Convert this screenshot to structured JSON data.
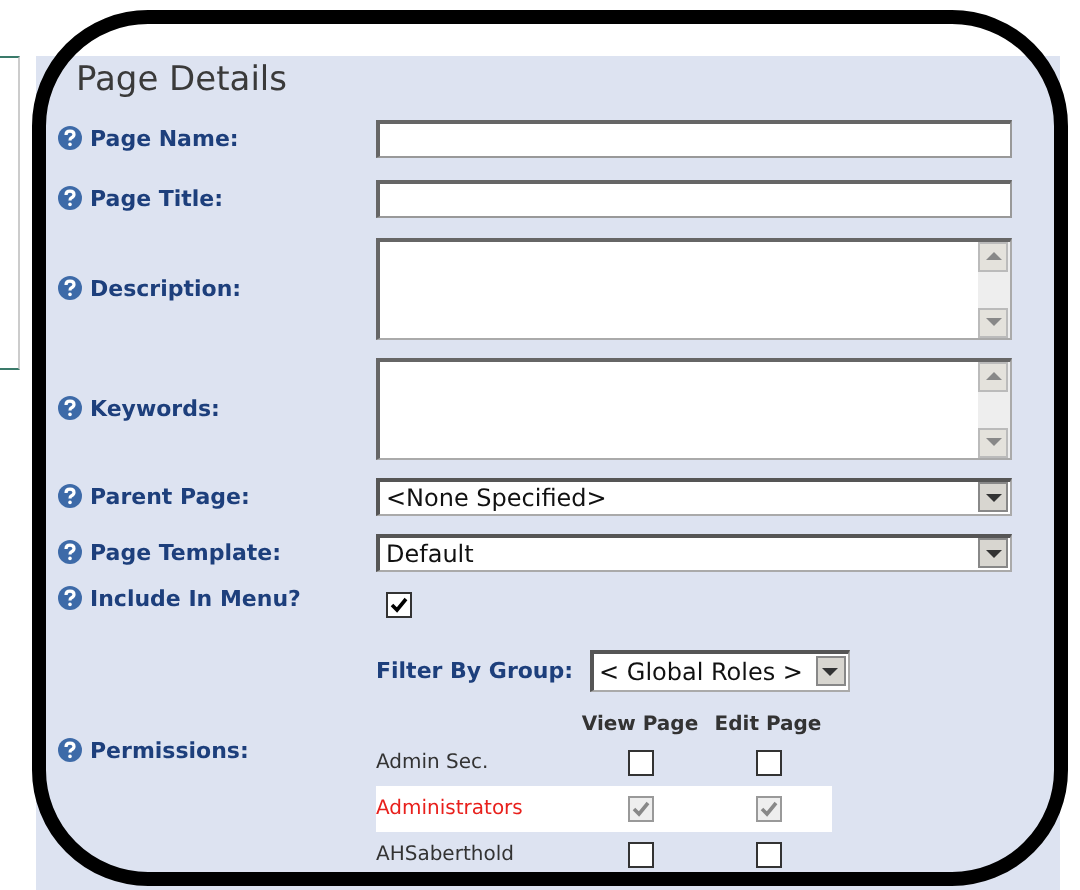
{
  "section": {
    "title": "Page Details"
  },
  "fields": [
    {
      "kind": "text",
      "label": "Page Name:"
    },
    {
      "kind": "text",
      "label": "Page Title:"
    },
    {
      "kind": "textarea",
      "label": "Description:"
    },
    {
      "kind": "textarea",
      "label": "Keywords:"
    },
    {
      "kind": "select",
      "label": "Parent Page:",
      "value": "<None Specified>"
    },
    {
      "kind": "select",
      "label": "Page Template:",
      "value": "Default"
    },
    {
      "kind": "checkbox",
      "label": "Include In Menu?",
      "checked": true
    }
  ],
  "permissions": {
    "label": "Permissions:",
    "filter_label": "Filter By Group:",
    "filter_value": "< Global Roles >",
    "columns": [
      "View Page",
      "Edit Page"
    ],
    "rows": [
      {
        "name": "Admin Sec.",
        "view": false,
        "edit": false,
        "disabled": false,
        "highlighted": false
      },
      {
        "name": "Administrators",
        "view": true,
        "edit": true,
        "disabled": true,
        "highlighted": true
      },
      {
        "name": "AHSaberthold",
        "view": false,
        "edit": false,
        "disabled": false,
        "highlighted": false
      }
    ]
  }
}
